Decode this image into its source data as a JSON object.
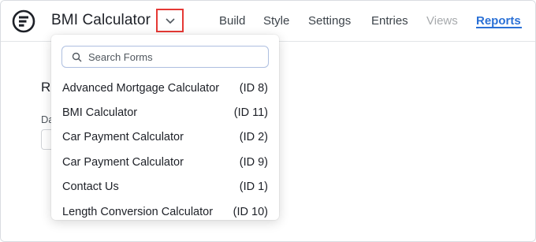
{
  "header": {
    "form_title": "BMI Calculator",
    "switch_icon": "chevron-down-icon"
  },
  "nav": [
    {
      "label": "Build",
      "state": "normal"
    },
    {
      "label": "Style",
      "state": "normal"
    },
    {
      "label": "Settings",
      "state": "normal"
    },
    {
      "label": "Entries",
      "state": "normal"
    },
    {
      "label": "Views",
      "state": "disabled"
    },
    {
      "label": "Reports",
      "state": "active"
    }
  ],
  "page": {
    "heading": "Re",
    "sub_label": "Da"
  },
  "dropdown": {
    "search_placeholder": "Search Forms",
    "items": [
      {
        "name": "Advanced Mortgage Calculator",
        "id": "(ID 8)"
      },
      {
        "name": "BMI Calculator",
        "id": "(ID 11)"
      },
      {
        "name": "Car Payment Calculator",
        "id": "(ID 2)"
      },
      {
        "name": "Car Payment Calculator",
        "id": "(ID 9)"
      },
      {
        "name": "Contact Us",
        "id": "(ID 1)"
      },
      {
        "name": "Length Conversion Calculator",
        "id": "(ID 10)"
      }
    ]
  },
  "colors": {
    "accent": "#2a70d6",
    "highlight_border": "#e53935",
    "disabled": "#a7aaad"
  }
}
